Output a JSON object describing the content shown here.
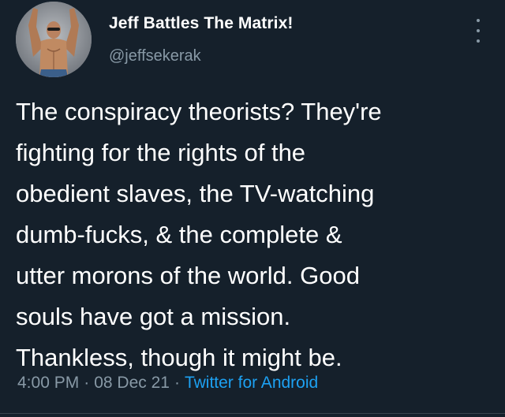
{
  "tweet": {
    "author": {
      "display_name": "Jeff Battles The Matrix!",
      "handle": "@jeffsekerak",
      "avatar_icon": "profile-photo"
    },
    "more_icon": "vertical-dots-icon",
    "text": "The conspiracy theorists? They're\nfighting for the rights of the\nobedient slaves, the TV-watching\ndumb-fucks, & the complete &\nutter morons of the world. Good\nsouls have got a mission.\nThankless, though it might be.",
    "time": "4:00 PM",
    "separator": "·",
    "date": "08 Dec 21",
    "source": "Twitter for Android"
  },
  "colors": {
    "background": "#15202b",
    "primary_text": "#ffffff",
    "secondary_text": "#8899a6",
    "accent": "#1da1f2"
  }
}
